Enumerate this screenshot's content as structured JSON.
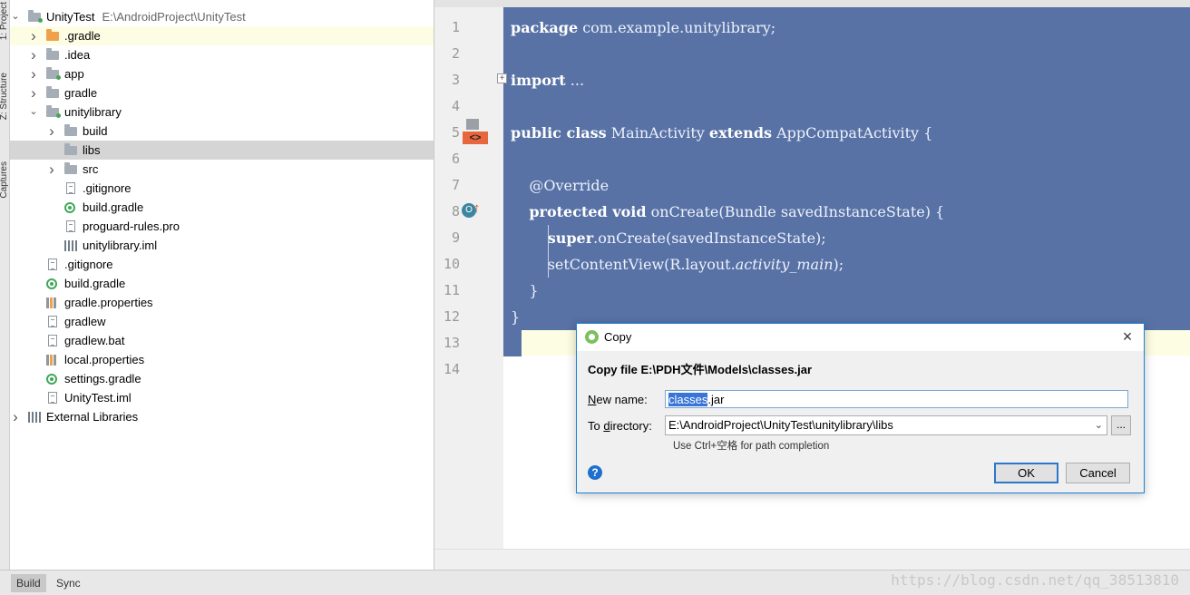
{
  "side_tabs": [
    "1: Project",
    "Z: Structure",
    "Captures"
  ],
  "tree": [
    {
      "name": "UnityTest",
      "extra": "E:\\AndroidProject\\UnityTest",
      "depth": 0,
      "arrow": "down",
      "icon": "folder-module"
    },
    {
      "name": ".gradle",
      "depth": 1,
      "arrow": "right",
      "icon": "folder-orange",
      "highlight": true
    },
    {
      "name": ".idea",
      "depth": 1,
      "arrow": "right",
      "icon": "folder"
    },
    {
      "name": "app",
      "depth": 1,
      "arrow": "right",
      "icon": "folder-module"
    },
    {
      "name": "gradle",
      "depth": 1,
      "arrow": "right",
      "icon": "folder"
    },
    {
      "name": "unitylibrary",
      "depth": 1,
      "arrow": "down",
      "icon": "folder-module"
    },
    {
      "name": "build",
      "depth": 2,
      "arrow": "right",
      "icon": "folder"
    },
    {
      "name": "libs",
      "depth": 2,
      "arrow": "",
      "icon": "folder",
      "selected": true
    },
    {
      "name": "src",
      "depth": 2,
      "arrow": "right",
      "icon": "folder"
    },
    {
      "name": ".gitignore",
      "depth": 2,
      "arrow": "",
      "icon": "file"
    },
    {
      "name": "build.gradle",
      "depth": 2,
      "arrow": "",
      "icon": "gradle"
    },
    {
      "name": "proguard-rules.pro",
      "depth": 2,
      "arrow": "",
      "icon": "file"
    },
    {
      "name": "unitylibrary.iml",
      "depth": 2,
      "arrow": "",
      "icon": "libs"
    },
    {
      "name": ".gitignore",
      "depth": 1,
      "arrow": "",
      "icon": "file"
    },
    {
      "name": "build.gradle",
      "depth": 1,
      "arrow": "",
      "icon": "gradle"
    },
    {
      "name": "gradle.properties",
      "depth": 1,
      "arrow": "",
      "icon": "props"
    },
    {
      "name": "gradlew",
      "depth": 1,
      "arrow": "",
      "icon": "file"
    },
    {
      "name": "gradlew.bat",
      "depth": 1,
      "arrow": "",
      "icon": "file"
    },
    {
      "name": "local.properties",
      "depth": 1,
      "arrow": "",
      "icon": "props"
    },
    {
      "name": "settings.gradle",
      "depth": 1,
      "arrow": "",
      "icon": "gradle"
    },
    {
      "name": "UnityTest.iml",
      "depth": 1,
      "arrow": "",
      "icon": "file"
    },
    {
      "name": "External Libraries",
      "depth": 0,
      "arrow": "right",
      "icon": "libs"
    }
  ],
  "editor": {
    "line_numbers": [
      "1",
      "2",
      "3",
      "4",
      "5",
      "6",
      "7",
      "8",
      "9",
      "10",
      "11",
      "12",
      "13",
      "14"
    ],
    "lines": [
      [
        {
          "t": "package",
          "k": "kw"
        },
        {
          "t": " com.example.unitylibrary;"
        }
      ],
      [],
      [
        {
          "t": "import",
          "k": "kw"
        },
        {
          "t": " ..."
        }
      ],
      [],
      [
        {
          "t": "public class",
          "k": "kw"
        },
        {
          "t": " MainActivity "
        },
        {
          "t": "extends",
          "k": "kw"
        },
        {
          "t": " AppCompatActivity {"
        }
      ],
      [],
      [
        {
          "t": "    @Override"
        }
      ],
      [
        {
          "t": "    "
        },
        {
          "t": "protected void",
          "k": "kw"
        },
        {
          "t": " onCreate(Bundle savedInstanceState) {"
        }
      ],
      [
        {
          "t": "        "
        },
        {
          "t": "super",
          "k": "kw"
        },
        {
          "t": ".onCreate(savedInstanceState);"
        }
      ],
      [
        {
          "t": "        setContentView(R.layout."
        },
        {
          "t": "activity_main",
          "k": "it"
        },
        {
          "t": ");"
        }
      ],
      [
        {
          "t": "    }"
        }
      ],
      [
        {
          "t": "}"
        }
      ],
      []
    ]
  },
  "dialog": {
    "title": "Copy",
    "heading": "Copy file E:\\PDH文件\\Models\\classes.jar",
    "new_name_label_u": "N",
    "new_name_label_rest": "ew name:",
    "new_name_selected": "classes",
    "new_name_rest": ".jar",
    "to_dir_label_pre": "To ",
    "to_dir_label_u": "d",
    "to_dir_label_rest": "irectory:",
    "to_dir_value": "E:\\AndroidProject\\UnityTest\\unitylibrary\\libs",
    "browse_label": "...",
    "hint": "Use Ctrl+空格 for path completion",
    "ok_label": "OK",
    "cancel_label": "Cancel",
    "help_label": "?"
  },
  "bottom_tabs": [
    "Build",
    "Sync"
  ],
  "watermark": "https://blog.csdn.net/qq_38513810"
}
